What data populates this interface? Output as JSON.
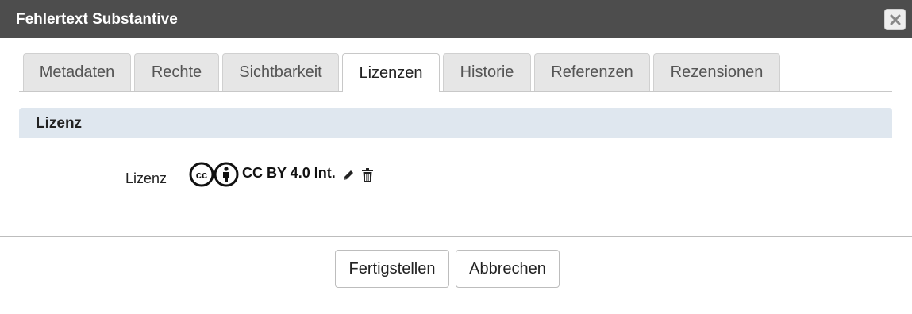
{
  "dialog": {
    "title": "Fehlertext Substantive"
  },
  "tabs": [
    {
      "label": "Metadaten",
      "active": false
    },
    {
      "label": "Rechte",
      "active": false
    },
    {
      "label": "Sichtbarkeit",
      "active": false
    },
    {
      "label": "Lizenzen",
      "active": true
    },
    {
      "label": "Historie",
      "active": false
    },
    {
      "label": "Referenzen",
      "active": false
    },
    {
      "label": "Rezensionen",
      "active": false
    }
  ],
  "section": {
    "title": "Lizenz",
    "field_label": "Lizenz",
    "license_value": "CC BY 4.0 Int.",
    "license_icons": [
      "cc-icon",
      "by-attribution-icon"
    ],
    "actions": [
      "edit-pencil-icon",
      "delete-trash-icon"
    ]
  },
  "footer": {
    "finish_label": "Fertigstellen",
    "cancel_label": "Abbrechen"
  },
  "colors": {
    "titlebar": "#4d4d4d",
    "section_header": "#dfe7ef",
    "tab_inactive": "#e6e6e6"
  }
}
